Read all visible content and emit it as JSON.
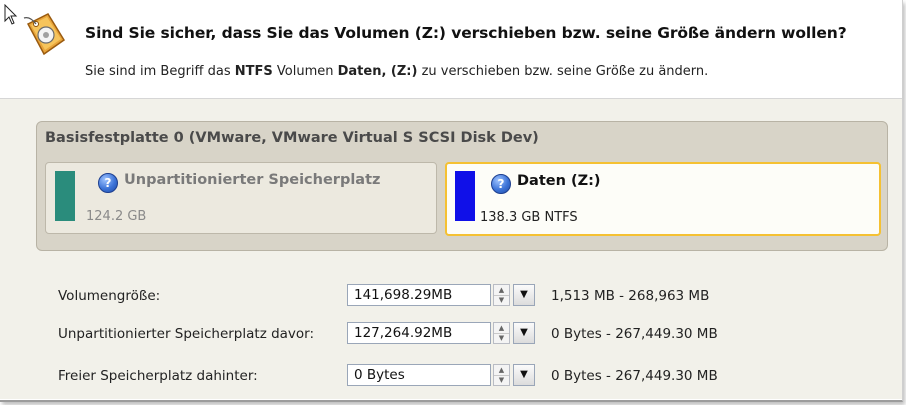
{
  "dialog": {
    "title": "Sind Sie sicher, dass Sie das Volumen (Z:) verschieben bzw. seine Größe ändern wollen?",
    "subtitle": {
      "part1": "Sie sind im Begriff das ",
      "fs": "NTFS",
      "part2": " Volumen ",
      "volume": "Daten, (Z:)",
      "part3": " zu verschieben bzw. seine Größe zu ändern."
    }
  },
  "disk": {
    "title": "Basisfestplatte 0 (VMware, VMware Virtual S SCSI Disk Dev)",
    "partitions": [
      {
        "name": "Unpartitionierter Speicherplatz",
        "info": "124.2 GB",
        "color": "#2a8c7c",
        "help_icon": "question-icon",
        "selected": false
      },
      {
        "name": "Daten (Z:)",
        "info": "138.3 GB NTFS",
        "color": "#1010e8",
        "help_icon": "question-icon",
        "selected": true
      }
    ]
  },
  "fields": [
    {
      "label": "Volumengröße:",
      "value": "141,698.29MB",
      "range": "1,513 MB - 268,963 MB"
    },
    {
      "label": "Unpartitionierter Speicherplatz davor:",
      "value": "127,264.92MB",
      "range": "0 Bytes - 267,449.30 MB"
    },
    {
      "label": "Freier Speicherplatz dahinter:",
      "value": "0 Bytes",
      "range": "0 Bytes - 267,449.30 MB"
    }
  ],
  "colors": {
    "selection_border": "#f5c132",
    "panel_bg": "#d8d4c8"
  }
}
